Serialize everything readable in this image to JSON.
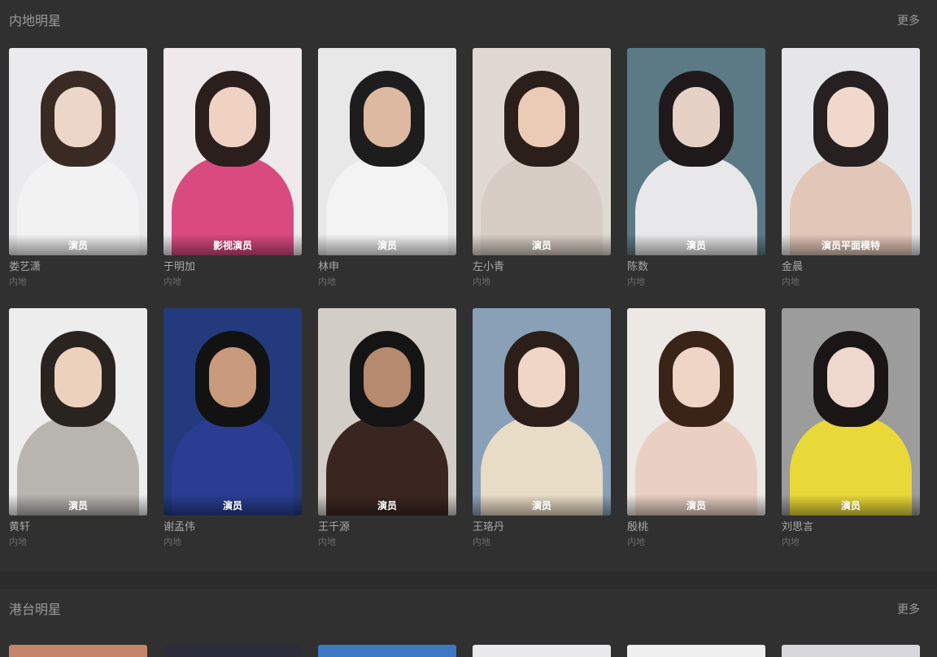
{
  "sections": [
    {
      "title": "内地明星",
      "more": "更多",
      "stars": [
        {
          "name": "娄艺潇",
          "region": "内地",
          "role": "演员",
          "bg": "#ebebee",
          "hair": "#3a2a24",
          "skin": "#ecd6c8",
          "body": "#f2f2f2"
        },
        {
          "name": "于明加",
          "region": "内地",
          "role": "影视演员",
          "bg": "#efe9ec",
          "hair": "#2a1f1d",
          "skin": "#f0d2c2",
          "body": "#d94a7e"
        },
        {
          "name": "林申",
          "region": "内地",
          "role": "演员",
          "bg": "#e8e8e8",
          "hair": "#1d1d1d",
          "skin": "#dcb9a0",
          "body": "#f3f3f3"
        },
        {
          "name": "左小青",
          "region": "内地",
          "role": "演员",
          "bg": "#e0d9d2",
          "hair": "#2b1f1a",
          "skin": "#ebcbb5",
          "body": "#d7cdc4"
        },
        {
          "name": "陈数",
          "region": "内地",
          "role": "演员",
          "bg": "#5c7a86",
          "hair": "#1f1a19",
          "skin": "#e6d1c6",
          "body": "#e8e8ea"
        },
        {
          "name": "金晨",
          "region": "内地",
          "role": "演员平面模特",
          "bg": "#e6e6e8",
          "hair": "#262020",
          "skin": "#f0d8cb",
          "body": "#e2c6b8"
        },
        {
          "name": "黄轩",
          "region": "内地",
          "role": "演员",
          "bg": "#ededed",
          "hair": "#2a2420",
          "skin": "#ecd2bd",
          "body": "#b8b5b0"
        },
        {
          "name": "谢孟伟",
          "region": "内地",
          "role": "演员",
          "bg": "#233b7c",
          "hair": "#121212",
          "skin": "#c99a7c",
          "body": "#2a3d92"
        },
        {
          "name": "王千源",
          "region": "内地",
          "role": "演员",
          "bg": "#d2cdc6",
          "hair": "#141414",
          "skin": "#b58a6e",
          "body": "#3a2620"
        },
        {
          "name": "王珞丹",
          "region": "内地",
          "role": "演员",
          "bg": "#8aa0b6",
          "hair": "#2c1f19",
          "skin": "#efd6c6",
          "body": "#e8dcc6"
        },
        {
          "name": "殷桃",
          "region": "内地",
          "role": "演员",
          "bg": "#ece8e4",
          "hair": "#3a2418",
          "skin": "#efd5c6",
          "body": "#e9d0c3"
        },
        {
          "name": "刘思言",
          "region": "内地",
          "role": "演员",
          "bg": "#9c9c9c",
          "hair": "#1a1616",
          "skin": "#eed7cc",
          "body": "#e8d838"
        }
      ]
    },
    {
      "title": "港台明星",
      "more": "更多",
      "strip_colors": [
        "#c4856a",
        "#2b2d3a",
        "#3f78c4",
        "#e9e9ec",
        "#f0f0f0",
        "#d8d8dc"
      ]
    }
  ]
}
